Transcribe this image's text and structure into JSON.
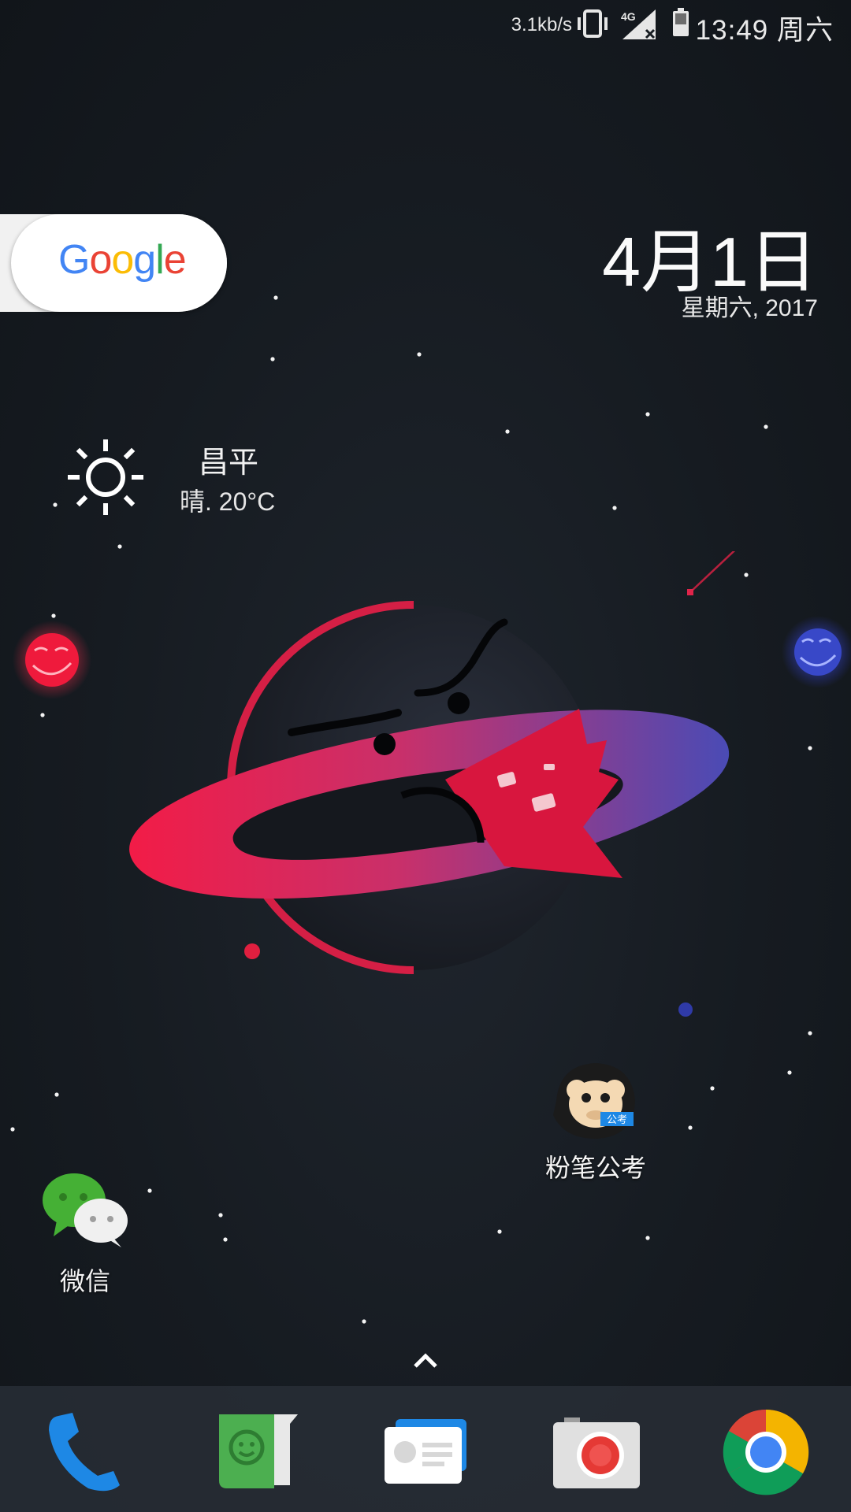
{
  "status_bar": {
    "network_speed": "3.1kb/s",
    "network_type": "4G",
    "time": "13:49",
    "weekday": "周六",
    "icons": [
      "vibrate-icon",
      "signal-4g-icon",
      "battery-icon"
    ]
  },
  "search_widget": {
    "logo_text": [
      "G",
      "o",
      "o",
      "g",
      "l",
      "e"
    ],
    "logo_colors": [
      "#4285F4",
      "#EA4335",
      "#FBBC05",
      "#4285F4",
      "#34A853",
      "#EA4335"
    ]
  },
  "clock_widget": {
    "date": "4月1日",
    "sub": "星期六, 2017"
  },
  "weather_widget": {
    "icon": "sun-icon",
    "city": "昌平",
    "condition": "晴. 20°C"
  },
  "home_apps": [
    {
      "name": "fenbi",
      "label": "粉笔公考",
      "icon": "fenbi-monkey-icon",
      "badge": "公考"
    },
    {
      "name": "wechat",
      "label": "微信",
      "icon": "wechat-icon"
    }
  ],
  "dock": [
    {
      "name": "phone",
      "icon": "phone-icon",
      "color": "#1e88e5"
    },
    {
      "name": "messaging",
      "icon": "messaging-icon",
      "color": "#4caf50"
    },
    {
      "name": "contacts",
      "icon": "contacts-icon",
      "color": "#2196f3"
    },
    {
      "name": "camera",
      "icon": "camera-icon",
      "color": "#e53935"
    },
    {
      "name": "chrome",
      "icon": "chrome-icon",
      "color": "#4285F4"
    }
  ],
  "drawer_icon": "chevron-up-icon",
  "colors": {
    "background": "#161b21",
    "accent_red": "#ee1e4a",
    "accent_blue": "#3a43b8"
  }
}
